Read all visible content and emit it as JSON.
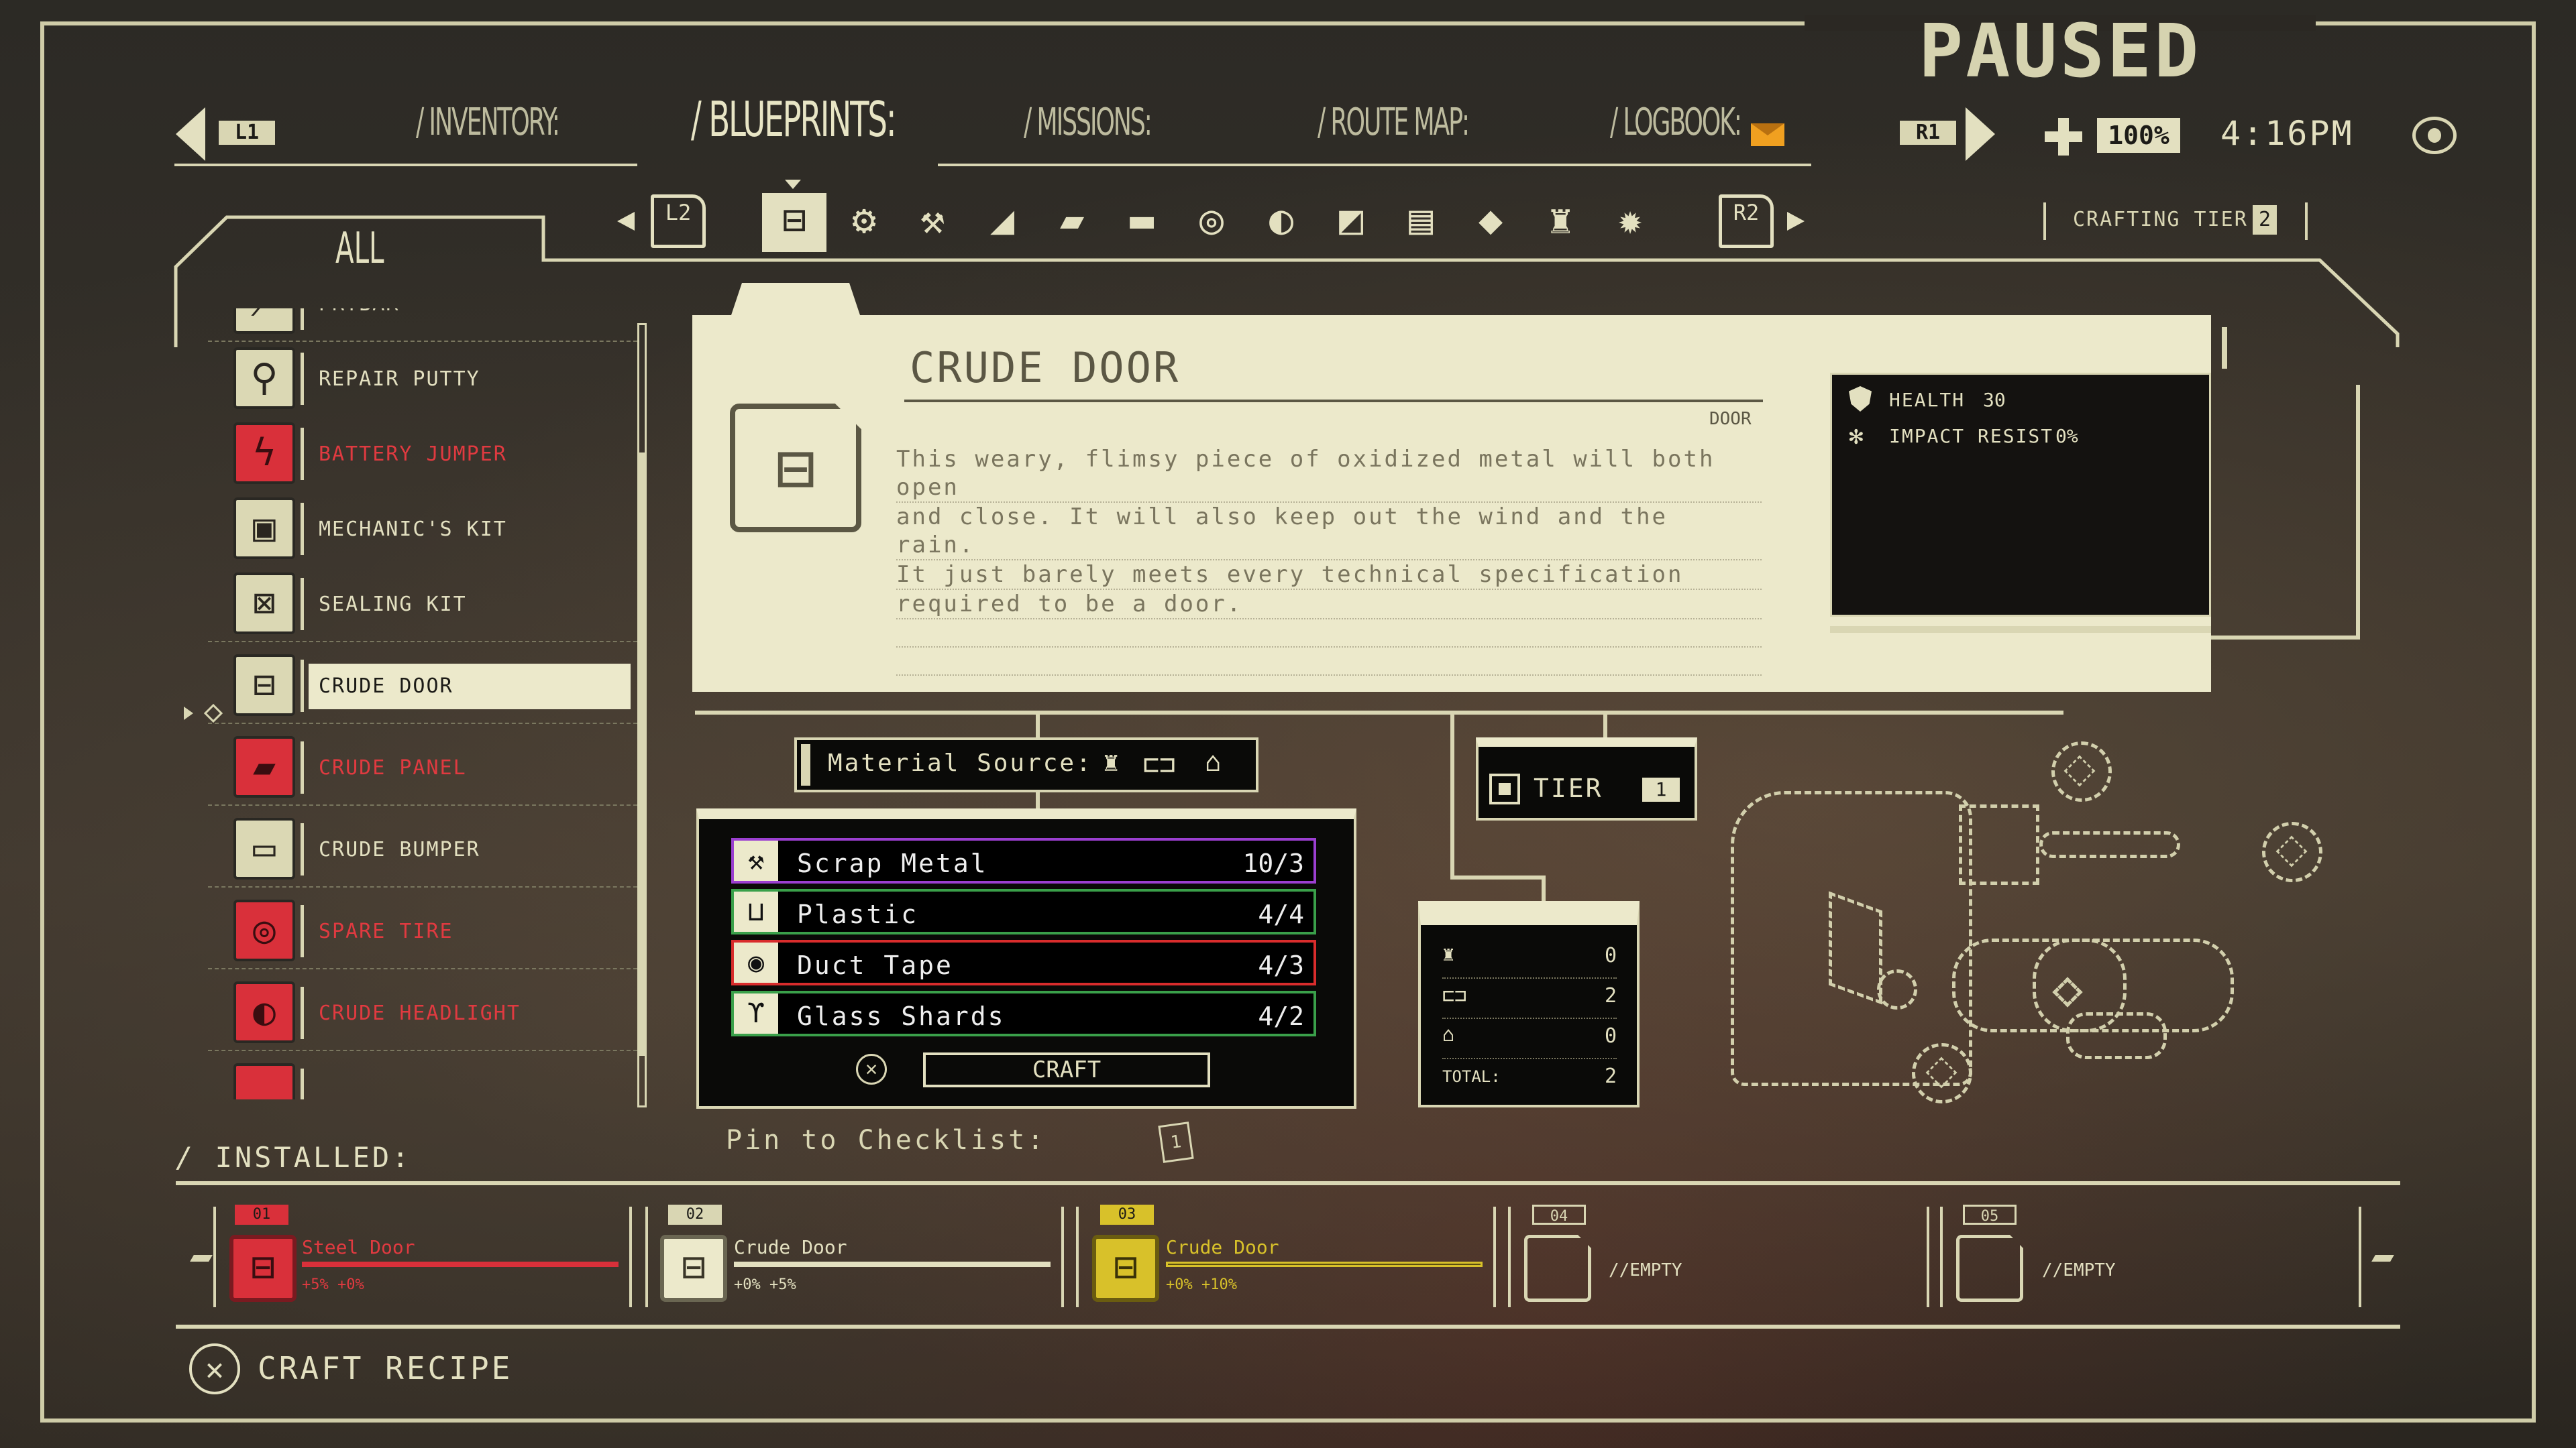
{
  "header": {
    "status": "PAUSED",
    "left_button": "L1",
    "right_button": "R1",
    "tabs": [
      "/ INVENTORY:",
      "/ BLUEPRINTS:",
      "/ MISSIONS:",
      "/ ROUTE MAP:",
      "/ LOGBOOK:"
    ],
    "active_tab": "/ BLUEPRINTS:",
    "health_percent": "100%",
    "time": "4:16PM"
  },
  "category_bar": {
    "left_button": "L2",
    "right_button": "R2",
    "crafting_tier_label": "CRAFTING TIER",
    "crafting_tier_value": "2",
    "icons": [
      "car-door-icon",
      "tools-icon",
      "wrench-icon",
      "seat-icon",
      "panel-icon",
      "bumper-icon",
      "tire-icon",
      "headlight-icon",
      "engine-icon",
      "battery-icon",
      "gearbox-icon",
      "fuel-icon",
      "gear-icon"
    ]
  },
  "sidebar": {
    "filter_label": "ALL",
    "items": [
      {
        "label": "PRYBAR",
        "red": false,
        "icon": "prybar-icon"
      },
      {
        "label": "REPAIR PUTTY",
        "red": false,
        "icon": "putty-icon"
      },
      {
        "label": "BATTERY JUMPER",
        "red": true,
        "icon": "jumper-icon"
      },
      {
        "label": "MECHANIC'S KIT",
        "red": false,
        "icon": "mechanic-kit-icon"
      },
      {
        "label": "SEALING KIT",
        "red": false,
        "icon": "sealing-kit-icon"
      },
      {
        "label": "CRUDE DOOR",
        "red": false,
        "icon": "crude-door-icon"
      },
      {
        "label": "CRUDE PANEL",
        "red": true,
        "icon": "crude-panel-icon"
      },
      {
        "label": "CRUDE BUMPER",
        "red": false,
        "icon": "crude-bumper-icon"
      },
      {
        "label": "SPARE TIRE",
        "red": true,
        "icon": "spare-tire-icon"
      },
      {
        "label": "CRUDE HEADLIGHT",
        "red": true,
        "icon": "crude-headlight-icon"
      }
    ],
    "selected": "CRUDE DOOR"
  },
  "detail": {
    "title": "CRUDE DOOR",
    "type": "DOOR",
    "description_lines": [
      "This weary, flimsy piece of oxidized metal will both open",
      "and close. It will also keep out the wind and the rain.",
      "It just barely meets every technical specification",
      "required to be a door."
    ],
    "stats": {
      "health_label": "HEALTH",
      "health_value": "30",
      "impact_label": "IMPACT RESIST",
      "impact_value": "0%"
    }
  },
  "material_source": {
    "label": "Material Source:"
  },
  "materials": [
    {
      "name": "Scrap Metal",
      "value": "10/3",
      "color": "#9b3fd0"
    },
    {
      "name": "Plastic",
      "value": "4/4",
      "color": "#3aa04a"
    },
    {
      "name": "Duct Tape",
      "value": "4/3",
      "color": "#d92c2c"
    },
    {
      "name": "Glass Shards",
      "value": "4/2",
      "color": "#3aa04a"
    }
  ],
  "craft_button": "CRAFT",
  "pin_label": "Pin to Checklist:",
  "pin_count": "1",
  "tier": {
    "label": "TIER",
    "value": "1"
  },
  "totals": {
    "rows": [
      "0",
      "2",
      "0"
    ],
    "total_label": "TOTAL:",
    "total_value": "2"
  },
  "installed": {
    "label": "INSTALLED:",
    "slots": [
      {
        "num": "01",
        "name": "Steel Door",
        "stats": "+5%  +0%",
        "style": "red",
        "fill": 1.0
      },
      {
        "num": "02",
        "name": "Crude Door",
        "stats": "+0%  +5%",
        "style": "cream",
        "fill": 1.0
      },
      {
        "num": "03",
        "name": "Crude Door",
        "stats": "+0%  +10%",
        "style": "yellow",
        "fill": 1.0
      },
      {
        "num": "04",
        "name": "//EMPTY",
        "stats": "",
        "style": "empty",
        "fill": 0
      },
      {
        "num": "05",
        "name": "//EMPTY",
        "stats": "",
        "style": "empty",
        "fill": 0
      }
    ]
  },
  "footer": {
    "action": "CRAFT RECIPE"
  },
  "colors": {
    "cream": "#ece9cb",
    "red": "#d9303a",
    "yellow": "#d8c12a",
    "accent_orange": "#f0a020"
  }
}
